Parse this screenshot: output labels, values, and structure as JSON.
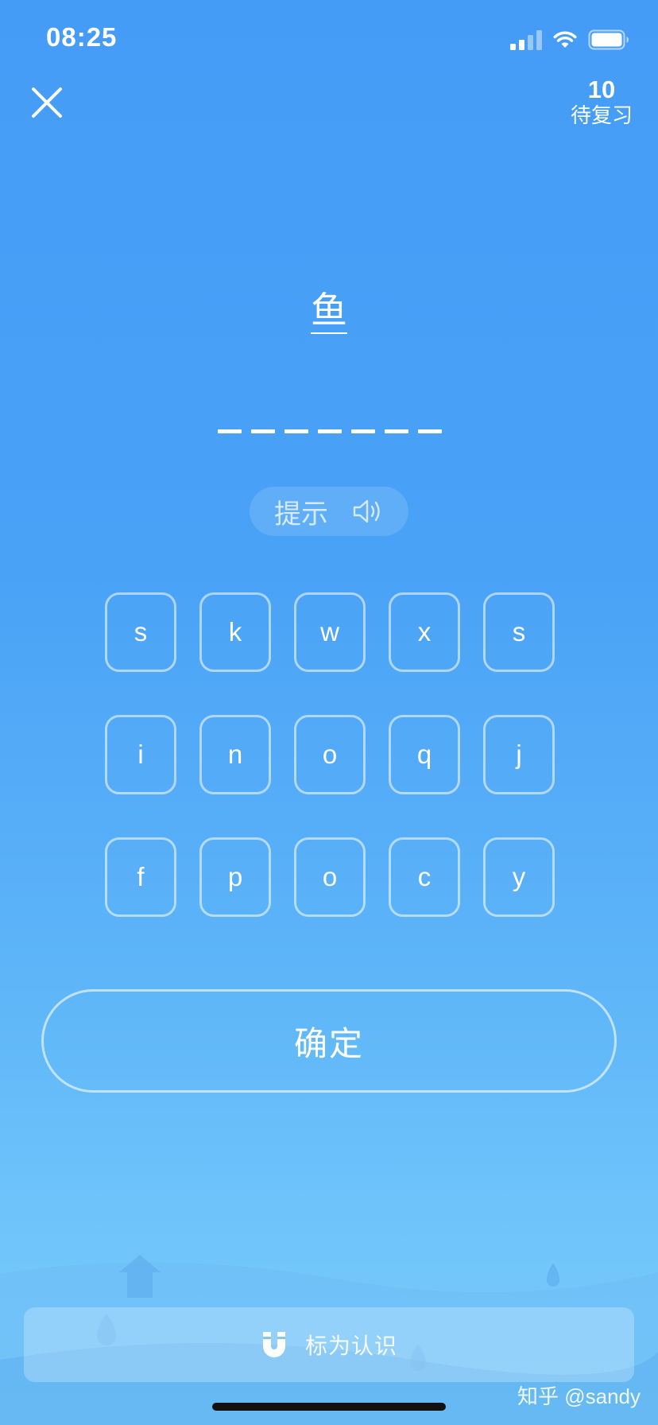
{
  "status_bar": {
    "time": "08:25"
  },
  "top_bar": {
    "review_count": "10",
    "review_label": "待复习"
  },
  "question": {
    "word": "鱼",
    "blank_count": 7
  },
  "hint": {
    "label": "提示"
  },
  "keyboard": {
    "rows": [
      [
        "s",
        "k",
        "w",
        "x",
        "s"
      ],
      [
        "i",
        "n",
        "o",
        "q",
        "j"
      ],
      [
        "f",
        "p",
        "o",
        "c",
        "y"
      ]
    ]
  },
  "confirm": {
    "label": "确定"
  },
  "mark_known": {
    "label": "标为认识"
  },
  "watermark": {
    "text": "知乎 @sandy"
  },
  "icons": {
    "close": "close-icon",
    "speaker": "speaker-icon",
    "magnet": "magnet-icon"
  }
}
